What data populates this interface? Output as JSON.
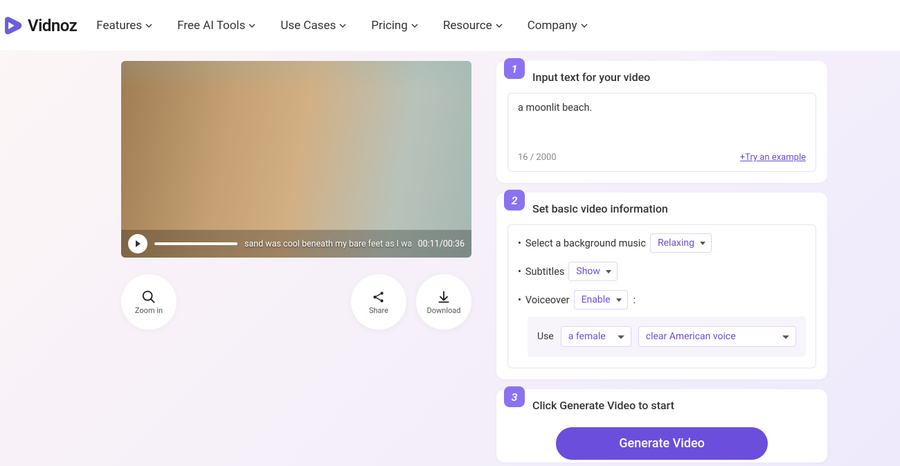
{
  "brand": {
    "name": "Vidnoz"
  },
  "nav": {
    "items": [
      "Features",
      "Free AI Tools",
      "Use Cases",
      "Pricing",
      "Resource",
      "Company"
    ]
  },
  "video": {
    "subtitle": "sand was cool beneath my bare feet as I walked along the water's edge.",
    "time": "00:11/00:36"
  },
  "actions": {
    "zoom": "Zoom in",
    "share": "Share",
    "download": "Download"
  },
  "step1": {
    "num": "1",
    "title": "Input text for your video",
    "text": "a moonlit beach.",
    "counter": "16 / 2000",
    "try": "+Try an example"
  },
  "step2": {
    "num": "2",
    "title": "Set basic video information",
    "bgmusic_label": "Select a background music",
    "bgmusic_value": "Relaxing",
    "subtitles_label": "Subtitles",
    "subtitles_value": "Show",
    "voiceover_label": "Voiceover",
    "voiceover_value": "Enable",
    "colon": ":",
    "use": "Use",
    "gender": "a female",
    "voice": "clear American voice"
  },
  "step3": {
    "num": "3",
    "title": "Click Generate Video to start",
    "button": "Generate Video"
  }
}
